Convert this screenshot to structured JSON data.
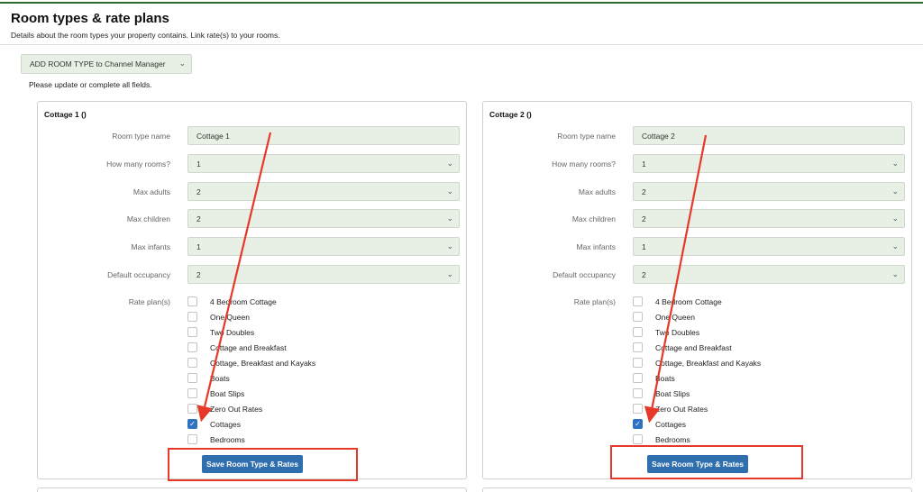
{
  "header": {
    "title": "Room types & rate plans",
    "subtitle": "Details about the room types your property contains. Link rate(s) to your rooms."
  },
  "add_room_type": {
    "label": "ADD ROOM TYPE to Channel Manager"
  },
  "note": "Please update or complete all fields.",
  "labels": {
    "room_type_name": "Room type name",
    "how_many_rooms": "How many rooms?",
    "max_adults": "Max adults",
    "max_children": "Max children",
    "max_infants": "Max infants",
    "default_occupancy": "Default occupancy",
    "rate_plans": "Rate plan(s)"
  },
  "rate_plan_names": [
    "4 Bedroom Cottage",
    "One Queen",
    "Two Doubles",
    "Cottage and Breakfast",
    "Cottage, Breakfast and Kayaks",
    "Boats",
    "Boat Slips",
    "Zero Out Rates",
    "Cottages",
    "Bedrooms"
  ],
  "rooms": [
    {
      "title": "Cottage 1 ()",
      "room_type_name": "Cottage 1",
      "how_many_rooms": "1",
      "max_adults": "2",
      "max_children": "2",
      "max_infants": "1",
      "default_occupancy": "2",
      "checked_rate_plans": [
        "Cottages"
      ],
      "save_label": "Save Room Type & Rates"
    },
    {
      "title": "Cottage 2 ()",
      "room_type_name": "Cottage 2",
      "how_many_rooms": "1",
      "max_adults": "2",
      "max_children": "2",
      "max_infants": "1",
      "default_occupancy": "2",
      "checked_rate_plans": [
        "Cottages"
      ],
      "save_label": "Save Room Type & Rates"
    }
  ],
  "colors": {
    "accent": "#2f6fae",
    "field_bg": "#e8f0e6",
    "annotation": "#e53a2a",
    "header_rule": "#2e6b2e"
  },
  "icons": {
    "select_chevron": "chevron-down-icon",
    "check": "check-icon"
  }
}
